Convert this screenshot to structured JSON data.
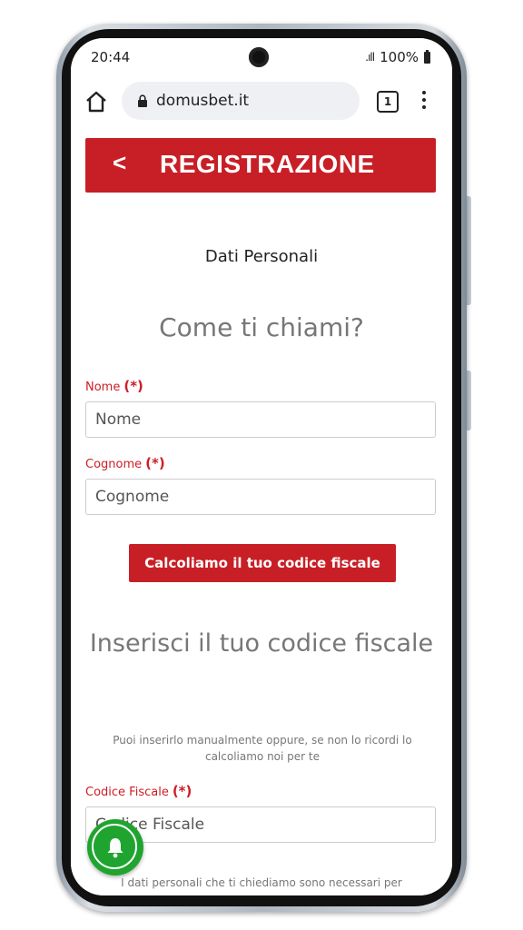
{
  "status": {
    "time": "20:44",
    "signal": ".ıll",
    "battery": "100%"
  },
  "browser": {
    "url": "domusbet.it",
    "tab_count": "1"
  },
  "header": {
    "back": "<",
    "title": "REGISTRAZIONE"
  },
  "form": {
    "section_title": "Dati Personali",
    "question": "Come ti chiami?",
    "required_marker": "(*)",
    "nome": {
      "label": "Nome",
      "placeholder": "Nome"
    },
    "cognome": {
      "label": "Cognome",
      "placeholder": "Cognome"
    },
    "calc_button": "Calcoliamo il tuo codice fiscale",
    "cf_title": "Inserisci il tuo codice fiscale",
    "cf_hint": "Puoi inserirlo manualmente oppure, se non lo ricordi lo calcoliamo noi per te",
    "codice_fiscale": {
      "label": "Codice Fiscale",
      "placeholder": "Codice Fiscale"
    },
    "privacy_text": "I dati personali che ti chiediamo sono necessari per"
  },
  "colors": {
    "brand_red": "#c81f26",
    "fab_green": "#1fa52f"
  },
  "icons": {
    "home": "home-icon",
    "lock": "lock-icon",
    "menu": "kebab-menu-icon",
    "notification": "bell-icon"
  }
}
